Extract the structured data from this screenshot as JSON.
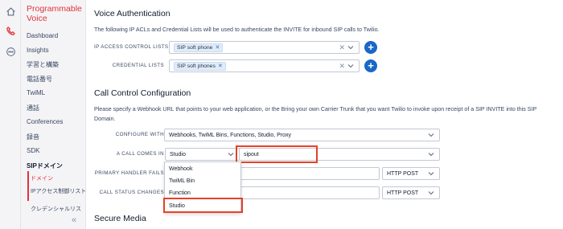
{
  "sidebar": {
    "product_title": "Programmable Voice",
    "items": [
      {
        "label": "Dashboard"
      },
      {
        "label": "Insights"
      },
      {
        "label": "学習と構築"
      },
      {
        "label": "電話番号"
      },
      {
        "label": "TwiML"
      },
      {
        "label": "通話"
      },
      {
        "label": "Conferences"
      },
      {
        "label": "録音"
      },
      {
        "label": "SDK"
      },
      {
        "label": "SIPドメイン"
      }
    ],
    "sub_items": [
      {
        "label": "ドメイン"
      },
      {
        "label": "IPアクセス制御リスト"
      },
      {
        "label": "クレデンシャルリス"
      }
    ],
    "collapse_glyph": "«"
  },
  "voice_auth": {
    "title": "Voice Authentication",
    "description": "The following IP ACLs and Credential Lists will be used to authenticate the INVITE for inbound SIP calls to Twilio.",
    "ip_acl": {
      "label": "IP ACCESS CONTROL LISTS",
      "chip": "SIP soft phone"
    },
    "credential": {
      "label": "CREDENTIAL LISTS",
      "chip": "SIP soft phones"
    }
  },
  "call_control": {
    "title": "Call Control Configuration",
    "description": "Please specify a Webhook URL that points to your web application, or the Bring your own Carrier Trunk that you want Twilio to invoke upon receipt of a SIP INVITE into this SIP Domain.",
    "configure_with": {
      "label": "CONFIGURE WITH",
      "value": "Webhooks, TwiML Bins, Functions, Studio, Proxy"
    },
    "a_call_comes_in": {
      "label": "A CALL COMES IN",
      "select_value": "Studio",
      "flow_value": "sipout"
    },
    "primary_handler_fails": {
      "label": "PRIMARY HANDLER FAILS",
      "method": "HTTP POST"
    },
    "call_status_changes": {
      "label": "CALL STATUS CHANGES",
      "method": "HTTP POST"
    }
  },
  "dropdown": {
    "options": [
      {
        "label": "Webhook"
      },
      {
        "label": "TwiML Bin"
      },
      {
        "label": "Function"
      },
      {
        "label": "Studio"
      }
    ]
  },
  "secure_media": {
    "title": "Secure Media"
  },
  "colors": {
    "brand_red": "#e0333a",
    "accent_blue": "#1a68c6",
    "highlight": "#e64126"
  },
  "icons": [
    "home-icon",
    "phone-icon",
    "more-icon",
    "close-icon",
    "chevron-down-icon",
    "plus-icon"
  ]
}
